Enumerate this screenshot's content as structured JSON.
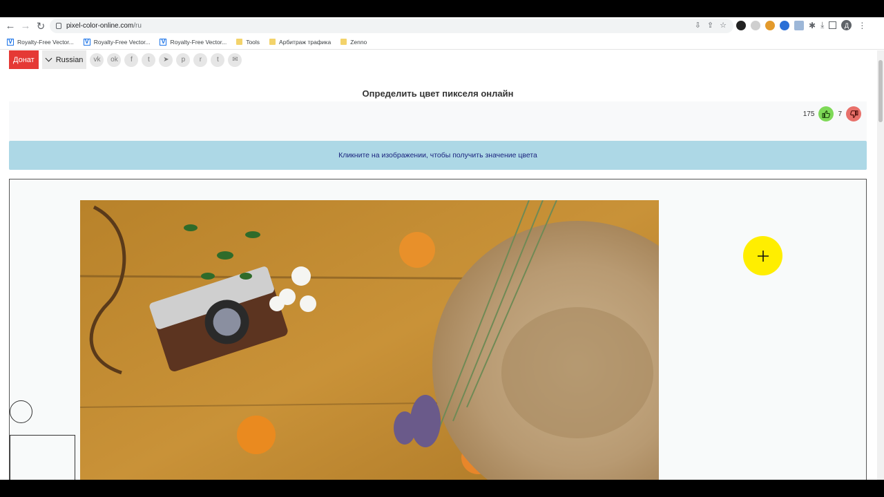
{
  "browser": {
    "url_host": "pixel-color-online.com",
    "url_path": "/ru",
    "profile_initial": "Д"
  },
  "bookmarks": [
    {
      "label": "Royalty-Free Vector...",
      "icon": "vectorstock-icon"
    },
    {
      "label": "Royalty-Free Vector...",
      "icon": "vectorstock-icon"
    },
    {
      "label": "Royalty-Free Vector...",
      "icon": "vectorstock-icon"
    },
    {
      "label": "Tools",
      "icon": "folder-icon"
    },
    {
      "label": "Арбитраж трафика",
      "icon": "folder-icon"
    },
    {
      "label": "Zenno",
      "icon": "folder-icon"
    }
  ],
  "topbar": {
    "donate_label": "Донат",
    "language_label": "Russian",
    "share_icons": [
      "vk-icon",
      "ok-icon",
      "facebook-icon",
      "twitter-icon",
      "telegram-icon",
      "pinterest-icon",
      "reddit-icon",
      "tumblr-icon",
      "email-icon"
    ],
    "share_glyphs": [
      "vk",
      "ok",
      "f",
      "t",
      "➤",
      "p",
      "r",
      "t",
      "✉"
    ]
  },
  "page": {
    "title": "Определить цвет пикселя онлайн",
    "likes": "175",
    "dislikes": "7",
    "hint": "Кликните на изображении, чтобы получить значение цвета"
  },
  "colors": {
    "donate": "#e53935",
    "hint_bg": "#add8e6",
    "like": "#7ed957",
    "dislike": "#e8706a",
    "picker": "#ffee00"
  }
}
